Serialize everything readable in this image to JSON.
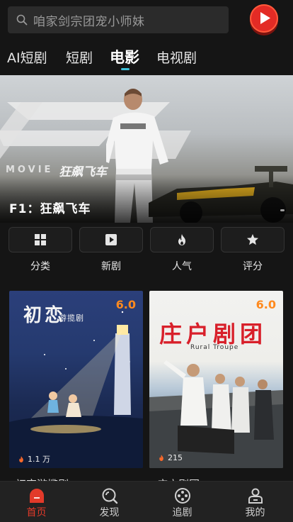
{
  "search": {
    "placeholder": "咱家剑宗团宠小师妹"
  },
  "tabs": [
    {
      "label": "AI短剧",
      "active": false
    },
    {
      "label": "短剧",
      "active": false
    },
    {
      "label": "电影",
      "active": true
    },
    {
      "label": "电视剧",
      "active": false
    }
  ],
  "banner": {
    "title": "F1：狂飙飞车",
    "movie_word": "MOVIE",
    "movie_cn": "狂飙飞车"
  },
  "quick_nav": [
    {
      "label": "分类",
      "icon": "grid-icon"
    },
    {
      "label": "新剧",
      "icon": "play-square-icon"
    },
    {
      "label": "人气",
      "icon": "flame-icon"
    },
    {
      "label": "评分",
      "icon": "star-icon"
    }
  ],
  "cards": [
    {
      "name": "初恋游揽剧",
      "score": "6.0",
      "views": "1.1 万",
      "poster_title": "初恋",
      "poster_subtitle": "游揽剧"
    },
    {
      "name": "庄户剧团",
      "score": "6.0",
      "views": "215",
      "poster_title": "庄户剧团",
      "poster_subtitle": "Rural Troupe"
    }
  ],
  "bottom_nav": [
    {
      "label": "首页",
      "icon": "home-icon",
      "active": true
    },
    {
      "label": "发现",
      "icon": "discover-icon",
      "active": false
    },
    {
      "label": "追剧",
      "icon": "follow-icon",
      "active": false
    },
    {
      "label": "我的",
      "icon": "profile-icon",
      "active": false
    }
  ],
  "colors": {
    "accent": "#e23a2a",
    "score": "#ff8a1e",
    "tab_indicator": "#3ec1d9",
    "background": "#151515"
  }
}
